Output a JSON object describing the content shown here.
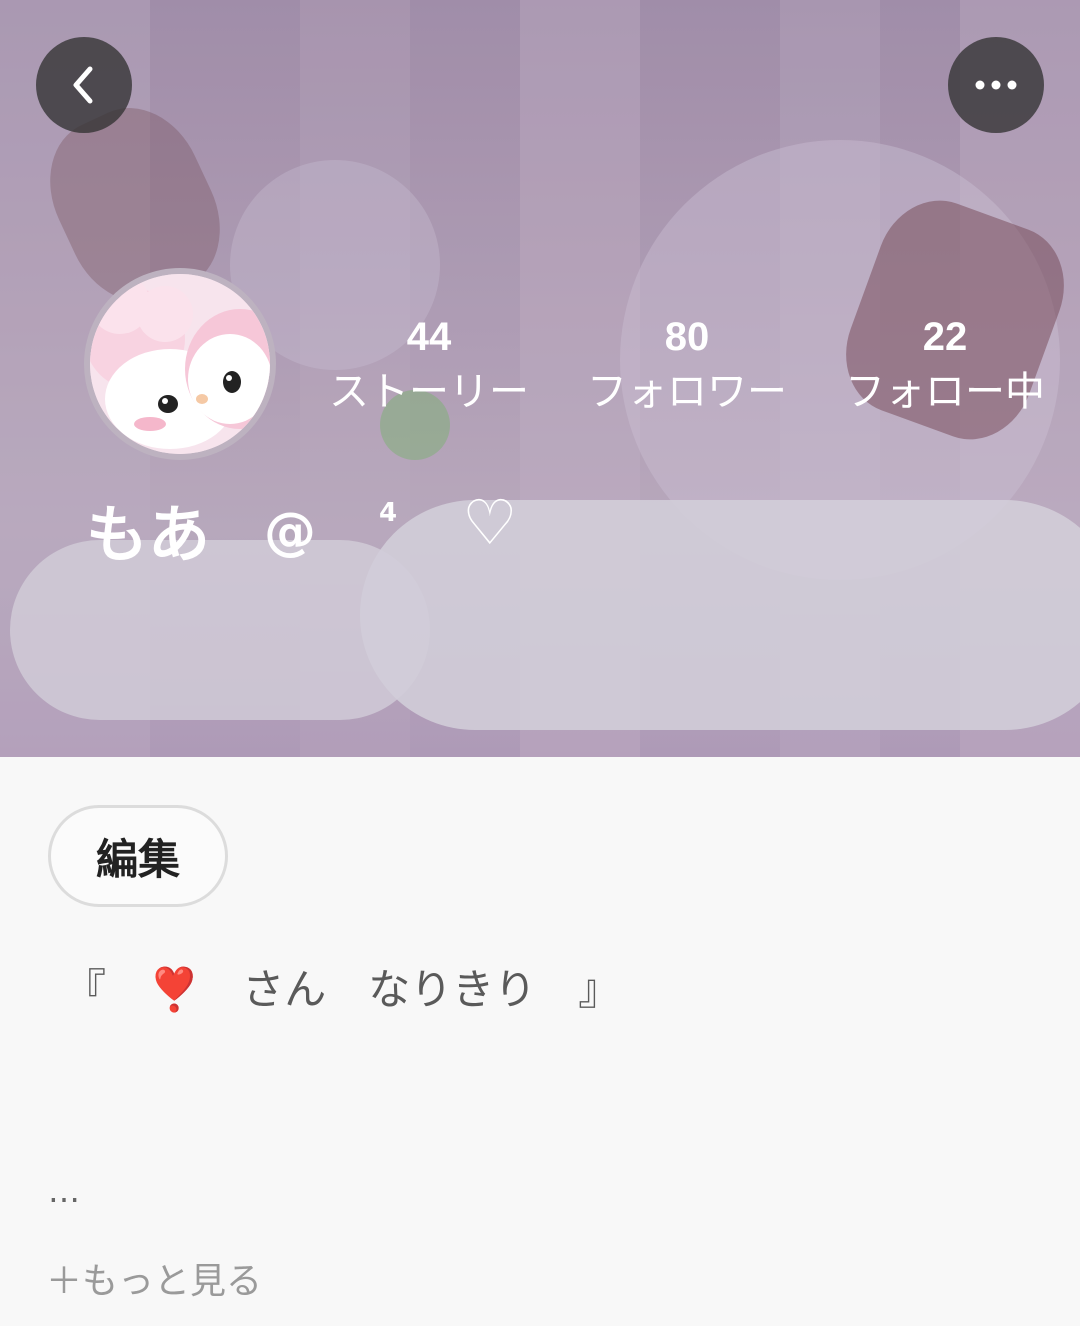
{
  "profile": {
    "display_name": "もあ",
    "name_at": "@",
    "name_sup": "4",
    "name_heart": "♡"
  },
  "stats": [
    {
      "count": "44",
      "label": "ストーリー"
    },
    {
      "count": "80",
      "label": "フォロワー"
    },
    {
      "count": "22",
      "label": "フォロー中"
    }
  ],
  "actions": {
    "edit_label": "編集"
  },
  "bio": {
    "text": "『　❣️　さん　なりきり　』",
    "truncated": "…",
    "more_label": "＋もっと見る"
  },
  "icons": {
    "back": "chevron-left-icon",
    "more": "more-horizontal-icon",
    "avatar": "pink-bunny-avatar"
  },
  "colors": {
    "header_tint": "#b9a8bf",
    "button_bg": "#333333",
    "text_on_header": "#ffffff",
    "page_bg": "#f8f8f8"
  }
}
